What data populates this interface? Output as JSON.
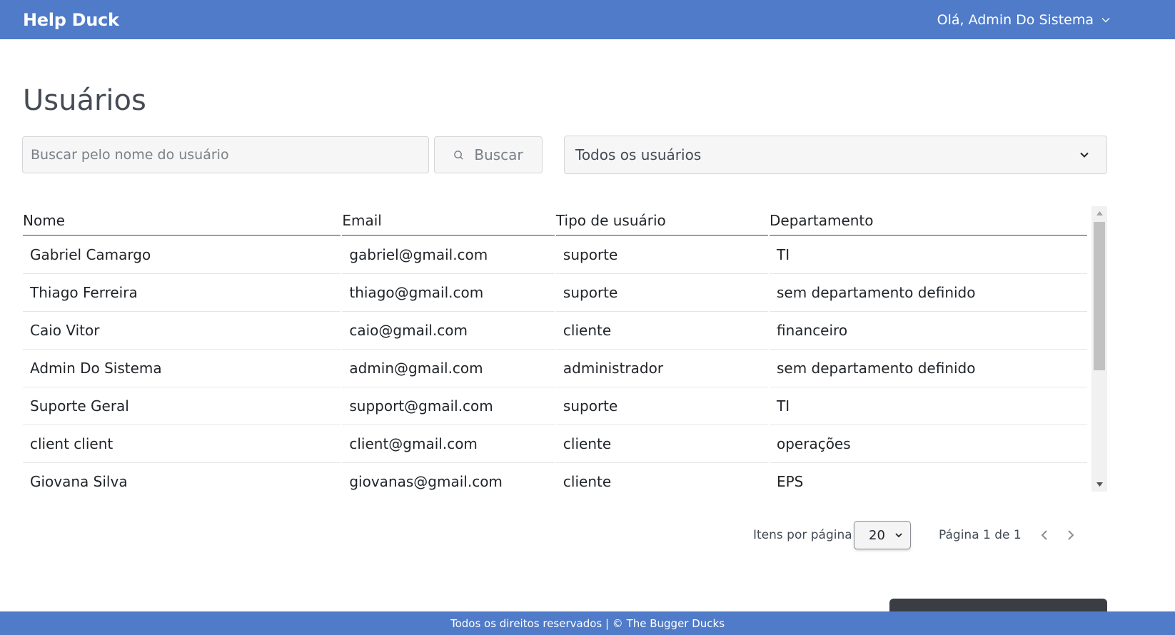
{
  "navbar": {
    "brand": "Help Duck",
    "user_greeting": "Olá, Admin Do Sistema"
  },
  "page": {
    "title": "Usuários"
  },
  "search": {
    "placeholder": "Buscar pelo nome do usuário",
    "value": "",
    "button_label": "Buscar"
  },
  "filter": {
    "selected": "Todos os usuários"
  },
  "table": {
    "columns": [
      "Nome",
      "Email",
      "Tipo de usuário",
      "Departamento"
    ],
    "rows": [
      [
        "Gabriel Camargo",
        "gabriel@gmail.com",
        "suporte",
        "TI"
      ],
      [
        "Thiago Ferreira",
        "thiago@gmail.com",
        "suporte",
        "sem departamento definido"
      ],
      [
        "Caio Vitor",
        "caio@gmail.com",
        "cliente",
        "financeiro"
      ],
      [
        "Admin Do Sistema",
        "admin@gmail.com",
        "administrador",
        "sem departamento definido"
      ],
      [
        "Suporte Geral",
        "support@gmail.com",
        "suporte",
        "TI"
      ],
      [
        "client client",
        "client@gmail.com",
        "cliente",
        "operações"
      ],
      [
        "Giovana Silva",
        "giovanas@gmail.com",
        "cliente",
        "EPS"
      ]
    ]
  },
  "pagination": {
    "items_per_page_label": "Itens por página",
    "items_per_page_value": "20",
    "page_info": "Página 1 de 1"
  },
  "footer": {
    "text": "Todos os direitos reservados | © The Bugger Ducks"
  },
  "colors": {
    "primary": "#4f7bc8",
    "text": "#212529",
    "muted": "#444b55"
  }
}
